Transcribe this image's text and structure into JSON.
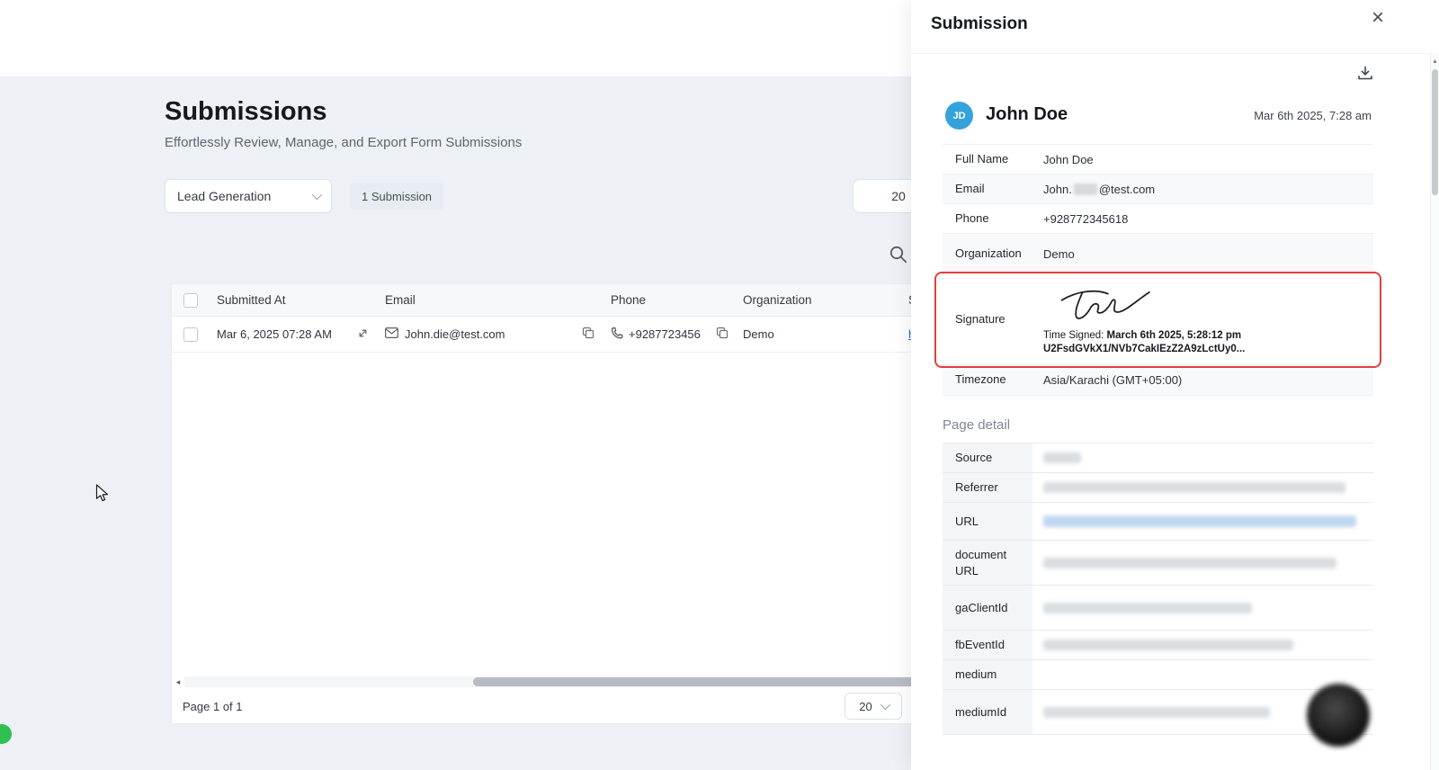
{
  "icons": {
    "close": "×",
    "scroll_left_arrow": "◂",
    "scroll_up_arrow": "▴"
  },
  "main": {
    "title": "Submissions",
    "subtitle": "Effortlessly Review, Manage, and Export Form Submissions",
    "toolbar": {
      "form_filter": "Lead Generation",
      "submission_count": "1 Submission",
      "page_size": "20"
    },
    "table": {
      "headers": {
        "submitted_at": "Submitted At",
        "email": "Email",
        "phone": "Phone",
        "organization": "Organization",
        "status": "S"
      },
      "row": {
        "submitted_at": "Mar 6, 2025 07:28 AM",
        "email": "John.die@test.com",
        "phone": "+9287723456",
        "organization": "Demo",
        "status_link": "h"
      }
    },
    "pagination": {
      "label": "Page 1 of 1",
      "page_size": "20"
    }
  },
  "panel": {
    "title": "Submission",
    "profile": {
      "initials": "JD",
      "name": "John Doe",
      "timestamp": "Mar 6th 2025, 7:28 am"
    },
    "fields": {
      "full_name": {
        "label": "Full Name",
        "value": "John Doe"
      },
      "email": {
        "label": "Email",
        "prefix": "John.",
        "suffix": "@test.com"
      },
      "phone": {
        "label": "Phone",
        "value": "+928772345618"
      },
      "organization": {
        "label": "Organization",
        "value": "Demo"
      },
      "signature": {
        "label": "Signature",
        "time_signed_prefix": "Time Signed: ",
        "time_signed_value": "March 6th 2025, 5:28:12 pm",
        "hash": "U2FsdGVkX1/NVb7CakIEzZ2A9zLctUy0..."
      },
      "timezone": {
        "label": "Timezone",
        "value": "Asia/Karachi (GMT+05:00)"
      }
    },
    "page_detail": {
      "heading": "Page detail",
      "rows": [
        {
          "label": "Source"
        },
        {
          "label": "Referrer"
        },
        {
          "label": "URL"
        },
        {
          "label": "documentURL"
        },
        {
          "label": "gaClientId"
        },
        {
          "label": "fbEventId"
        },
        {
          "label": "medium"
        },
        {
          "label": "mediumId"
        }
      ]
    }
  }
}
